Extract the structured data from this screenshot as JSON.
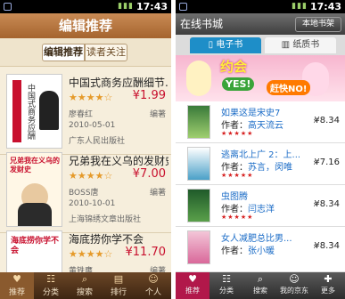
{
  "status_bar": {
    "time": "17:43"
  },
  "left_app": {
    "title": "编辑推荐",
    "tabs": [
      "编辑推荐",
      "读者关注"
    ],
    "books": [
      {
        "title": "中国式商务应酬细节...",
        "rating": "★★★★☆",
        "price": "¥1.99",
        "author": "廖春红",
        "tag": "编著",
        "date": "2010-05-01",
        "publisher": "广东人民出版社",
        "cover_text": "中国式商务应酬"
      },
      {
        "title": "兄弟我在义乌的发财史",
        "rating": "★★★★☆",
        "price": "¥7.00",
        "author": "BOSS唐",
        "tag": "编著",
        "date": "2010-10-01",
        "publisher": "上海锦绣文章出版社",
        "cover_text": "兄弟我在义乌的发财史"
      },
      {
        "title": "海底捞你学不会",
        "rating": "★★★★☆",
        "price": "¥11.70",
        "author": "黄铁鹰",
        "tag": "编著",
        "date": "",
        "publisher": "",
        "cover_text": "海底捞你学不会"
      }
    ],
    "nav": [
      {
        "label": "推荐",
        "icon": "heart-icon"
      },
      {
        "label": "分类",
        "icon": "grid-icon"
      },
      {
        "label": "搜索",
        "icon": "search-icon"
      },
      {
        "label": "排行",
        "icon": "chart-icon"
      },
      {
        "label": "个人",
        "icon": "person-icon"
      }
    ]
  },
  "right_app": {
    "title": "在线书城",
    "local_shelf_button": "本地书架",
    "tabs": [
      "电子书",
      "纸质书"
    ],
    "banner": {
      "line1": "约会",
      "line2": "YES!",
      "line3": "赶快NO!"
    },
    "books": [
      {
        "title": "如果这是宋史7",
        "author_label": "作者：",
        "author": "高天流云",
        "price": "¥8.34",
        "stars": "★★★★★"
      },
      {
        "title": "逃离北上广 2：上...",
        "author_label": "作者：",
        "author": "苏言，闵唯",
        "price": "¥7.16",
        "stars": "★★★★★"
      },
      {
        "title": "虫图腾",
        "author_label": "作者：",
        "author": "闫志洋",
        "price": "¥8.34",
        "stars": "★★★★★"
      },
      {
        "title": "女人减肥总比男...",
        "author_label": "作者：",
        "author": "张小暖",
        "price": "¥8.34",
        "stars": ""
      }
    ],
    "nav": [
      {
        "label": "推荐",
        "icon": "heart-icon"
      },
      {
        "label": "分类",
        "icon": "grid-icon"
      },
      {
        "label": "搜索",
        "icon": "search-icon"
      },
      {
        "label": "我的京东",
        "icon": "person-icon"
      },
      {
        "label": "更多",
        "icon": "plus-icon"
      }
    ]
  },
  "colors": {
    "left_header": "#a5642e",
    "left_background": "#f6eedc",
    "left_price": "#c8102e",
    "right_tab_active": "#1e8ec8",
    "right_nav_active": "#b1184a",
    "right_link": "#1b6cc7"
  }
}
